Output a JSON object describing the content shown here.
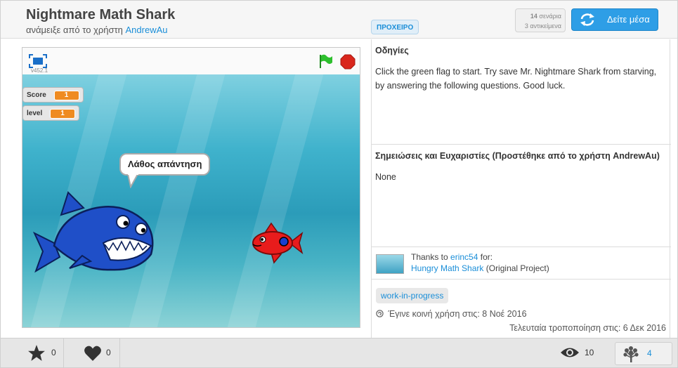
{
  "header": {
    "title": "Nightmare Math Shark",
    "byline_prefix": "ανάμειξε από το χρήστη",
    "author": "AndrewAu",
    "draft_label": "ΠΡΟΧΕΙΡΟ",
    "scripts_count": "14",
    "scripts_label": "σενάρια",
    "sprites_line": "3 αντικείμενα",
    "see_inside_label": "Δείτε μέσα"
  },
  "player": {
    "version": "v452.1",
    "monitors": [
      {
        "name": "Score",
        "value": "1"
      },
      {
        "name": "level",
        "value": "1"
      }
    ],
    "speech": "Λάθος απάντηση"
  },
  "instructions": {
    "heading": "Οδηγίες",
    "text": "Click the green flag to start. Try save Mr. Nightmare Shark from starving, by answering the following questions. Good luck."
  },
  "notes": {
    "heading": "Σημειώσεις και Ευχαριστίες (Προστέθηκε από το χρήστη AndrewAu)",
    "text": "None"
  },
  "credits": {
    "thanks_prefix": "Thanks to",
    "user": "erinc54",
    "for_label": "for:",
    "project": "Hungry Math Shark",
    "project_suffix": "(Original Project)"
  },
  "tags": [
    "work-in-progress"
  ],
  "dates": {
    "shared": "Έγινε κοινή χρήση στις: 8 Νοέ 2016",
    "modified": "Τελευταία τροποποίηση στις: 6 Δεκ 2016"
  },
  "stats": {
    "favorites": "0",
    "loves": "0",
    "views": "10",
    "remixes": "4"
  },
  "colors": {
    "accent": "#2e9ee6",
    "link": "#1a8ed8",
    "monitor_value": "#ef8b21",
    "flag": "#2ebf2e",
    "stop": "#d9261c"
  }
}
